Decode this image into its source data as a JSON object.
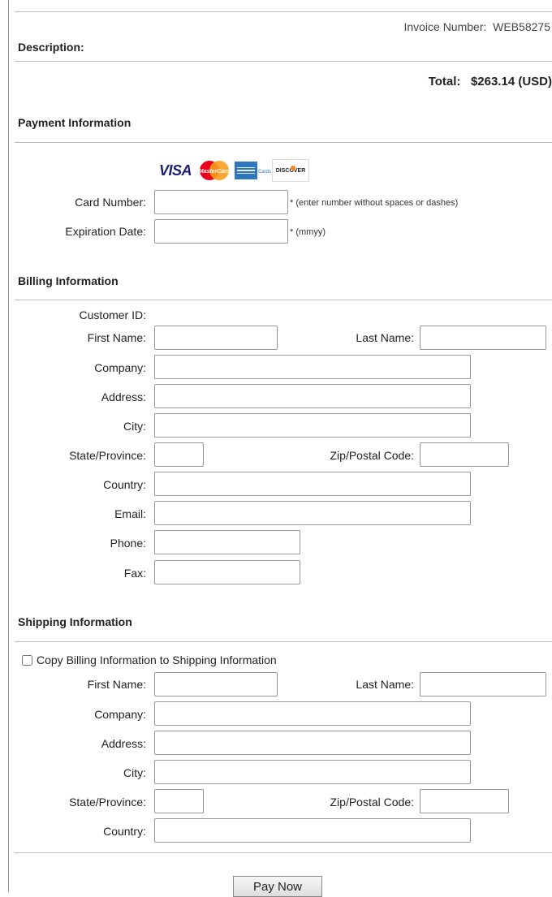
{
  "header": {
    "invoice_label": "Invoice Number:",
    "invoice_value": "WEB58275",
    "description_label": "Description:",
    "total_label": "Total:",
    "total_value": "$263.14 (USD)"
  },
  "payment": {
    "title": "Payment Information",
    "card_logos": [
      "VISA",
      "MasterCard",
      "AMERICAN EXPRESS Cards",
      "DISCOVER"
    ],
    "card_number_label": "Card Number:",
    "card_number_value": "",
    "card_number_hint": "* (enter number without spaces or dashes)",
    "expiration_label": "Expiration Date:",
    "expiration_value": "",
    "expiration_hint": "* (mmyy)"
  },
  "billing": {
    "title": "Billing Information",
    "customer_id_label": "Customer ID:",
    "first_name_label": "First Name:",
    "last_name_label": "Last Name:",
    "company_label": "Company:",
    "address_label": "Address:",
    "city_label": "City:",
    "state_label": "State/Province:",
    "zip_label": "Zip/Postal Code:",
    "country_label": "Country:",
    "email_label": "Email:",
    "phone_label": "Phone:",
    "fax_label": "Fax:"
  },
  "shipping": {
    "title": "Shipping Information",
    "copy_label": "Copy Billing Information to Shipping Information",
    "copy_checked": false,
    "first_name_label": "First Name:",
    "last_name_label": "Last Name:",
    "company_label": "Company:",
    "address_label": "Address:",
    "city_label": "City:",
    "state_label": "State/Province:",
    "zip_label": "Zip/Postal Code:",
    "country_label": "Country:"
  },
  "submit": {
    "label": "Pay Now"
  },
  "colors": {
    "visa_blue": "#1a1f71",
    "mastercard_red": "#eb001b",
    "mastercard_orange": "#f79e1b",
    "amex_blue": "#2e77bc",
    "discover_orange": "#f58220"
  }
}
